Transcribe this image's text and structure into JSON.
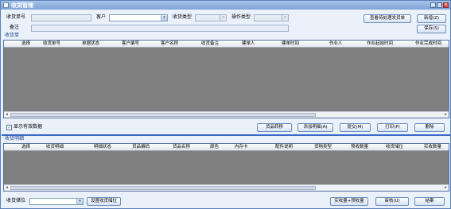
{
  "window": {
    "title": "收货管理",
    "controls": {
      "minimize": "_",
      "restore": "□",
      "close": "×"
    }
  },
  "header": {
    "order_no_label": "收货单号",
    "order_no_value": "",
    "customer_label": "客户",
    "customer_value": "",
    "receipt_type_label": "收货类型",
    "receipt_type_value": "",
    "operation_type_label": "操作类型",
    "operation_type_value": "",
    "remark_label": "备注",
    "remark_value": "",
    "btn_view_pending": "查看待处理发货单",
    "btn_new": "新增(Z)",
    "btn_save": "保存(S)"
  },
  "orders_section": {
    "title": "收货单",
    "columns": [
      "选择",
      "收货单号",
      "单据状态",
      "客户编号",
      "客户名称",
      "收货备注",
      "建单人",
      "建单时间",
      "作业人",
      "作业起始时间",
      "作业完成时间"
    ],
    "rows": []
  },
  "orders_toolbar": {
    "show_valid_label": "显示有效数据",
    "show_valid_checked": true,
    "btn_goods_transfer": "货品转移",
    "btn_add_detail": "添加明细(A)",
    "btn_submit": "提交(M)",
    "btn_print": "打印(P)",
    "btn_delete": "删除"
  },
  "details_section": {
    "title": "收货明细",
    "columns": [
      "选择",
      "收货明细",
      "明细状态",
      "货品编码",
      "货品名称",
      "颜色",
      "内存卡",
      "配件说明",
      "货物类型",
      "预收数量",
      "收货储位",
      "实收数量"
    ],
    "rows": []
  },
  "footer": {
    "location_label": "收货储位",
    "location_value": "",
    "btn_set_location": "设置收货储位",
    "btn_actual_plus_pre": "实收量+预收量",
    "btn_review": "审核(U)",
    "btn_finish": "结案"
  },
  "scroll": {
    "left_arrow": "◂",
    "right_arrow": "▸",
    "down_arrow": "▾"
  }
}
